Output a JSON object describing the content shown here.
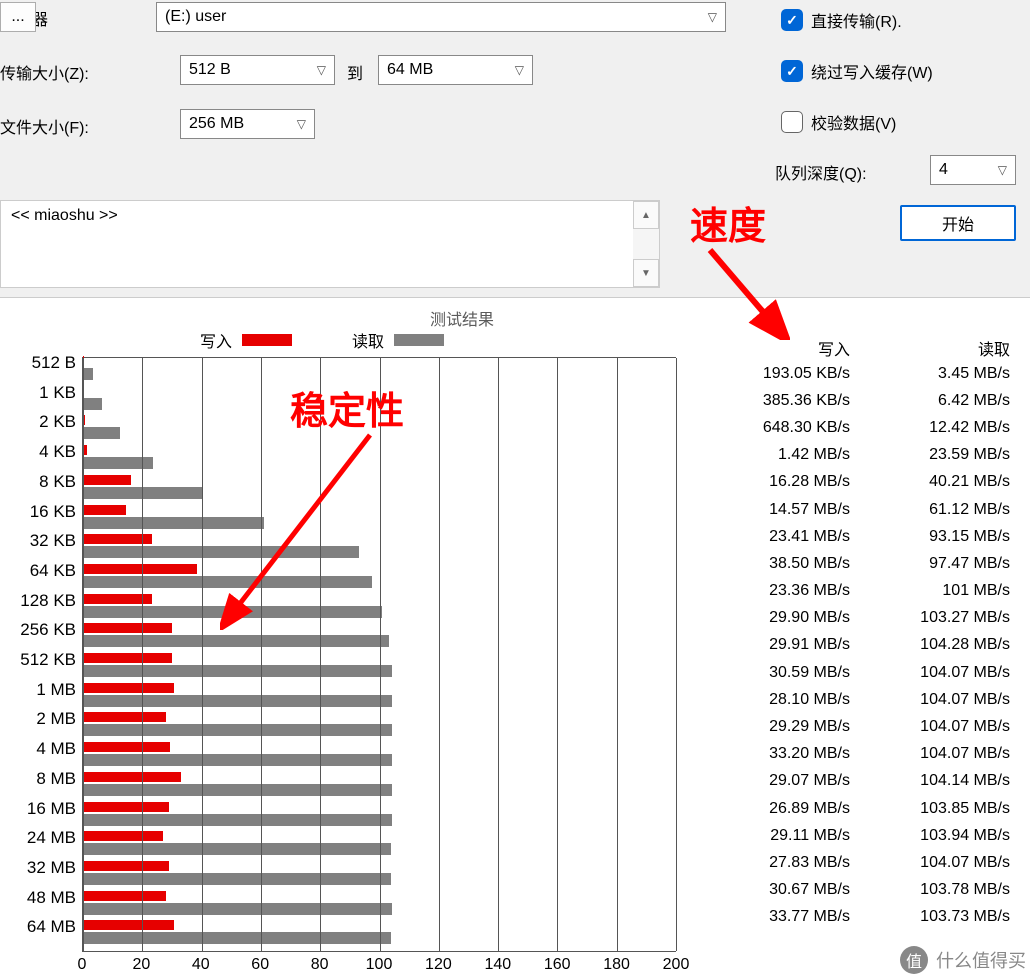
{
  "labels": {
    "drive": "驱动器",
    "browse": "...",
    "transfer_size": "传输大小(Z):",
    "to": "到",
    "file_size": "文件大小(F):",
    "direct_transfer": "直接传输(R).",
    "bypass_cache": "绕过写入缓存(W)",
    "check_data": "校验数据(V)",
    "queue_depth": "队列深度(Q):",
    "start": "开始",
    "desc": "<< miaoshu >>",
    "result_title": "测试结果",
    "legend_write": "写入",
    "legend_read": "读取",
    "speed_header_write": "写入",
    "speed_header_read": "读取",
    "anno_speed": "速度",
    "anno_stability": "稳定性",
    "watermark": "什么值得买"
  },
  "values": {
    "drive": "(E:) user",
    "tmin": "512 B",
    "tmax": "64 MB",
    "file_size": "256 MB",
    "queue_depth": "4"
  },
  "chart_data": {
    "type": "bar",
    "title": "测试结果",
    "xlabel": "",
    "ylabel": "",
    "xlim": [
      0,
      200
    ],
    "xticks": [
      0,
      20,
      40,
      60,
      80,
      100,
      120,
      140,
      160,
      180,
      200
    ],
    "categories": [
      "512 B",
      "1 KB",
      "2 KB",
      "4 KB",
      "8 KB",
      "16 KB",
      "32 KB",
      "64 KB",
      "128 KB",
      "256 KB",
      "512 KB",
      "1 MB",
      "2 MB",
      "4 MB",
      "8 MB",
      "16 MB",
      "24 MB",
      "32 MB",
      "48 MB",
      "64 MB"
    ],
    "series": [
      {
        "name": "写入",
        "color": "#e60000",
        "values": [
          0.19,
          0.38,
          0.65,
          1.42,
          16.28,
          14.57,
          23.41,
          38.5,
          23.36,
          29.9,
          29.91,
          30.59,
          28.1,
          29.29,
          33.2,
          29.07,
          26.89,
          29.11,
          27.83,
          30.67
        ]
      },
      {
        "name": "读取",
        "color": "#808080",
        "values": [
          3.45,
          6.42,
          12.42,
          23.59,
          40.21,
          61.12,
          93.15,
          97.47,
          101,
          103.27,
          104.28,
          104.07,
          104.07,
          104.07,
          104.07,
          104.14,
          103.85,
          103.94,
          104.07,
          103.78
        ]
      }
    ],
    "table": [
      {
        "write": "193.05 KB/s",
        "read": "3.45 MB/s"
      },
      {
        "write": "385.36 KB/s",
        "read": "6.42 MB/s"
      },
      {
        "write": "648.30 KB/s",
        "read": "12.42 MB/s"
      },
      {
        "write": "1.42 MB/s",
        "read": "23.59 MB/s"
      },
      {
        "write": "16.28 MB/s",
        "read": "40.21 MB/s"
      },
      {
        "write": "14.57 MB/s",
        "read": "61.12 MB/s"
      },
      {
        "write": "23.41 MB/s",
        "read": "93.15 MB/s"
      },
      {
        "write": "38.50 MB/s",
        "read": "97.47 MB/s"
      },
      {
        "write": "23.36 MB/s",
        "read": "101 MB/s"
      },
      {
        "write": "29.90 MB/s",
        "read": "103.27 MB/s"
      },
      {
        "write": "29.91 MB/s",
        "read": "104.28 MB/s"
      },
      {
        "write": "30.59 MB/s",
        "read": "104.07 MB/s"
      },
      {
        "write": "28.10 MB/s",
        "read": "104.07 MB/s"
      },
      {
        "write": "29.29 MB/s",
        "read": "104.07 MB/s"
      },
      {
        "write": "33.20 MB/s",
        "read": "104.07 MB/s"
      },
      {
        "write": "29.07 MB/s",
        "read": "104.14 MB/s"
      },
      {
        "write": "26.89 MB/s",
        "read": "103.85 MB/s"
      },
      {
        "write": "29.11 MB/s",
        "read": "103.94 MB/s"
      },
      {
        "write": "27.83 MB/s",
        "read": "104.07 MB/s"
      },
      {
        "write": "30.67 MB/s",
        "read": "103.78 MB/s"
      },
      {
        "write": "33.77 MB/s",
        "read": "103.73 MB/s"
      }
    ]
  }
}
